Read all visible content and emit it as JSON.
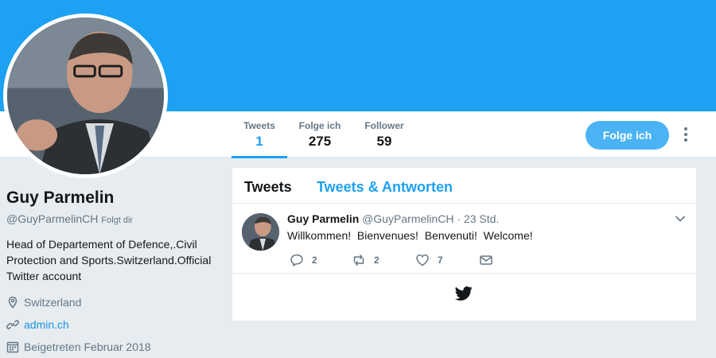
{
  "colors": {
    "brand": "#1da1f2",
    "follow_button": "#4ab3f4",
    "muted": "#657786",
    "link": "#1b95e0"
  },
  "nav": {
    "stats": [
      {
        "label": "Tweets",
        "value": "1"
      },
      {
        "label": "Folge ich",
        "value": "275"
      },
      {
        "label": "Follower",
        "value": "59"
      }
    ],
    "follow_label": "Folge ich",
    "more_icon": "more-vertical-icon"
  },
  "profile": {
    "name": "Guy Parmelin",
    "handle": "@GuyParmelinCH",
    "follows_you": "Folgt dir",
    "bio": "Head of Departement of Defence,.Civil Protection and Sports.Switzerland.Official Twitter account",
    "location": "Switzerland",
    "website": "admin.ch",
    "joined": "Beigetreten Februar 2018"
  },
  "timeline": {
    "tabs": [
      "Tweets",
      "Tweets & Antworten"
    ],
    "tweet": {
      "name": "Guy Parmelin",
      "handle": "@GuyParmelinCH",
      "separator": "·",
      "time": "23 Std.",
      "text": "Willkommen!  Bienvenues!  Benvenuti!  Welcome!",
      "replies": "2",
      "retweets": "2",
      "likes": "7"
    }
  }
}
